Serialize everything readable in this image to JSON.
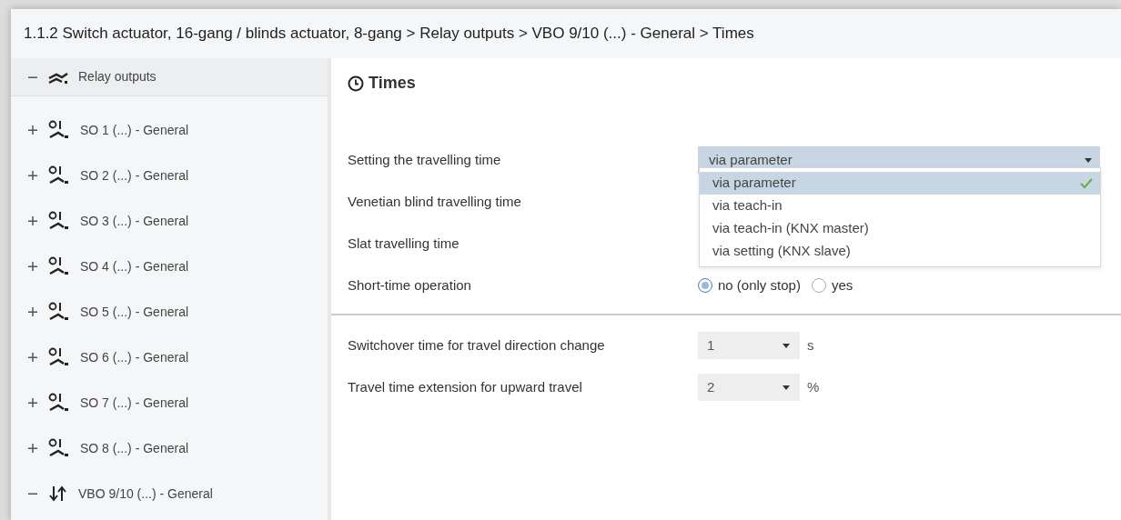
{
  "window": {
    "title": "1.1.2 Switch actuator, 16-gang / blinds actuator, 8-gang > Relay outputs > VBO 9/10 (...) - General > Times"
  },
  "sidebar": {
    "items": [
      {
        "label": "Relay outputs",
        "kind": "group",
        "expanded": true,
        "selected": false
      },
      {
        "label": "SO 1 (...) - General",
        "kind": "relay",
        "expanded": false,
        "selected": false
      },
      {
        "label": "SO 2 (...) - General",
        "kind": "relay",
        "expanded": false,
        "selected": false
      },
      {
        "label": "SO 3 (...) - General",
        "kind": "relay",
        "expanded": false,
        "selected": false
      },
      {
        "label": "SO 4 (...) - General",
        "kind": "relay",
        "expanded": false,
        "selected": false
      },
      {
        "label": "SO 5 (...) - General",
        "kind": "relay",
        "expanded": false,
        "selected": false
      },
      {
        "label": "SO 6 (...) - General",
        "kind": "relay",
        "expanded": false,
        "selected": false
      },
      {
        "label": "SO 7 (...) - General",
        "kind": "relay",
        "expanded": false,
        "selected": false
      },
      {
        "label": "SO 8 (...) - General",
        "kind": "relay",
        "expanded": false,
        "selected": false
      },
      {
        "label": "VBO 9/10 (...) - General",
        "kind": "blind",
        "expanded": true,
        "selected": false
      }
    ]
  },
  "panel": {
    "title": "Times",
    "rows": [
      {
        "kind": "dropdown",
        "label": "Setting the travelling time",
        "value": "via parameter",
        "open": true,
        "options": [
          {
            "label": "via parameter",
            "selected": true
          },
          {
            "label": "via teach-in",
            "selected": false
          },
          {
            "label": "via teach-in (KNX master)",
            "selected": false
          },
          {
            "label": "via setting (KNX slave)",
            "selected": false
          }
        ]
      },
      {
        "kind": "hidden",
        "label": "Venetian blind travelling time"
      },
      {
        "kind": "hidden",
        "label": "Slat travelling time"
      },
      {
        "kind": "radio",
        "label": "Short-time operation",
        "options": [
          {
            "label": "no (only stop)",
            "selected": true
          },
          {
            "label": "yes",
            "selected": false
          }
        ]
      },
      {
        "kind": "divider"
      },
      {
        "kind": "select",
        "label": "Switchover time for travel direction change",
        "value": "1",
        "unit": "s"
      },
      {
        "kind": "select",
        "label": "Travel time extension for upward travel",
        "value": "2",
        "unit": "%"
      }
    ]
  }
}
